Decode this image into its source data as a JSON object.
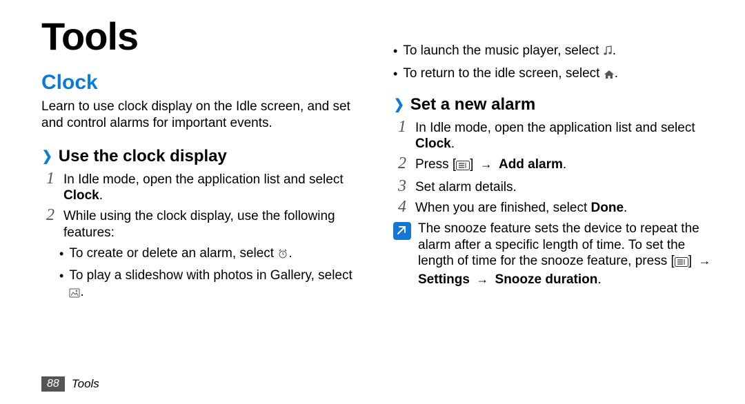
{
  "page": {
    "title": "Tools",
    "number": "88",
    "footer_label": "Tools"
  },
  "icons": {
    "arrow": "→"
  },
  "left": {
    "section_title": "Clock",
    "intro": "Learn to use clock display on the Idle screen, and set and control alarms for important events.",
    "sub1": {
      "label": "Use the clock display",
      "step1_pre": "In Idle mode, open the application list and select ",
      "step1_bold": "Clock",
      "step1_post": ".",
      "step2": "While using the clock display, use the following features:",
      "b1_pre": "To create or delete an alarm, select ",
      "b1_post": ".",
      "b2_pre": "To play a slideshow with photos in Gallery, select ",
      "b2_post": "."
    }
  },
  "right": {
    "pre_bullets": {
      "b3_pre": "To launch the music player, select ",
      "b3_post": ".",
      "b4_pre": "To return to the idle screen, select ",
      "b4_post": "."
    },
    "sub2": {
      "label": "Set a new alarm",
      "step1_pre": "In Idle mode, open the application list and select ",
      "step1_bold": "Clock",
      "step1_post": ".",
      "step2_pre": "Press [",
      "step2_mid": "] ",
      "step2_bold": "Add alarm",
      "step2_post": ".",
      "step3": "Set alarm details.",
      "step4_pre": "When you are finished, select ",
      "step4_bold": "Done",
      "step4_post": ".",
      "note_part1": "The snooze feature sets the device to repeat the alarm after a specific length of time. To set the length of time for the snooze feature, press [",
      "note_mid": "] ",
      "note_bold1": "Settings",
      "note_arrow": "→",
      "note_bold2": "Snooze duration",
      "note_post": "."
    }
  }
}
